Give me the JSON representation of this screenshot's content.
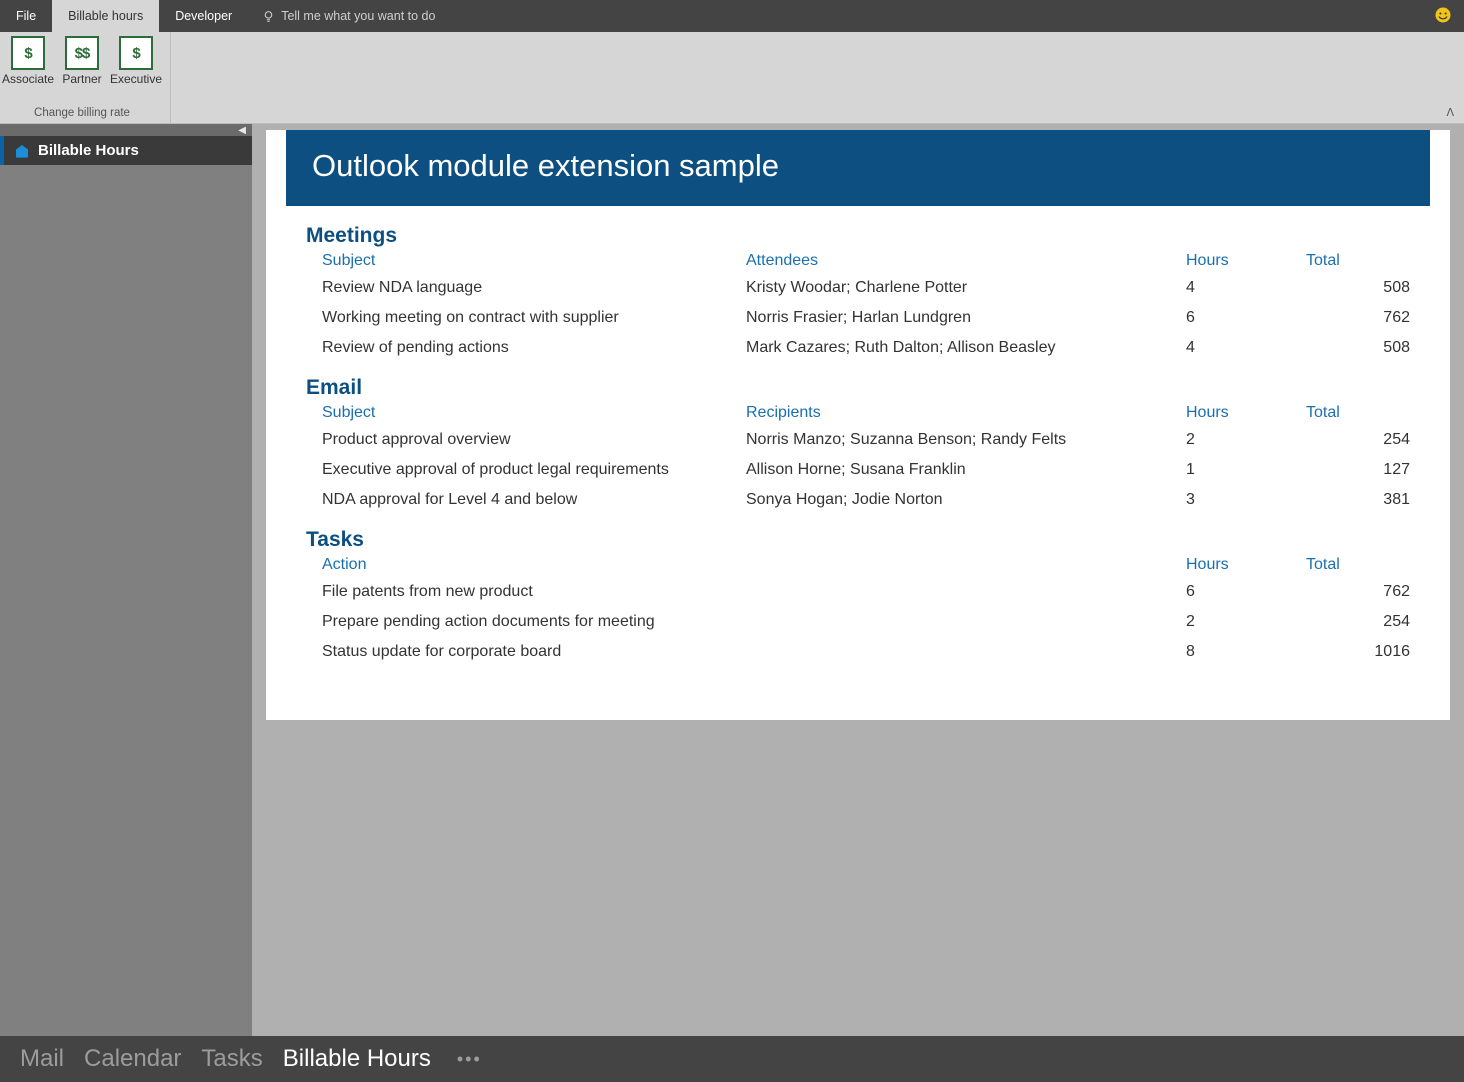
{
  "top_tabs": {
    "file": "File",
    "billable": "Billable hours",
    "developer": "Developer",
    "tellme_placeholder": "Tell me what you want to do"
  },
  "ribbon": {
    "buttons": [
      {
        "icon": "$",
        "label": "Associate"
      },
      {
        "icon": "$$",
        "label": "Partner"
      },
      {
        "icon": "$",
        "label": "Executive"
      }
    ],
    "group_label": "Change billing rate"
  },
  "sidebar": {
    "item_label": "Billable Hours"
  },
  "banner_title": "Outlook module extension sample",
  "sections": {
    "meetings": {
      "title": "Meetings",
      "headers": {
        "c1": "Subject",
        "c2": "Attendees",
        "c3": "Hours",
        "c4": "Total"
      },
      "rows": [
        {
          "c1": "Review NDA language",
          "c2": "Kristy Woodar; Charlene Potter",
          "c3": "4",
          "c4": "508"
        },
        {
          "c1": "Working meeting on contract with supplier",
          "c2": "Norris Frasier; Harlan Lundgren",
          "c3": "6",
          "c4": "762"
        },
        {
          "c1": "Review of pending actions",
          "c2": "Mark Cazares; Ruth Dalton; Allison Beasley",
          "c3": "4",
          "c4": "508"
        }
      ]
    },
    "email": {
      "title": "Email",
      "headers": {
        "c1": "Subject",
        "c2": "Recipients",
        "c3": "Hours",
        "c4": "Total"
      },
      "rows": [
        {
          "c1": "Product approval overview",
          "c2": "Norris Manzo; Suzanna Benson; Randy Felts",
          "c3": "2",
          "c4": "254"
        },
        {
          "c1": "Executive approval of product legal requirements",
          "c2": "Allison Horne; Susana Franklin",
          "c3": "1",
          "c4": "127"
        },
        {
          "c1": "NDA approval for Level 4 and below",
          "c2": "Sonya Hogan; Jodie Norton",
          "c3": "3",
          "c4": "381"
        }
      ]
    },
    "tasks": {
      "title": "Tasks",
      "headers": {
        "c1": "Action",
        "c2": "",
        "c3": "Hours",
        "c4": "Total"
      },
      "rows": [
        {
          "c1": "File patents from new product",
          "c2": "",
          "c3": "6",
          "c4": "762"
        },
        {
          "c1": "Prepare pending action documents for meeting",
          "c2": "",
          "c3": "2",
          "c4": "254"
        },
        {
          "c1": "Status update for corporate board",
          "c2": "",
          "c3": "8",
          "c4": "1016"
        }
      ]
    }
  },
  "bottom_nav": {
    "mail": "Mail",
    "calendar": "Calendar",
    "tasks": "Tasks",
    "billable": "Billable Hours"
  }
}
